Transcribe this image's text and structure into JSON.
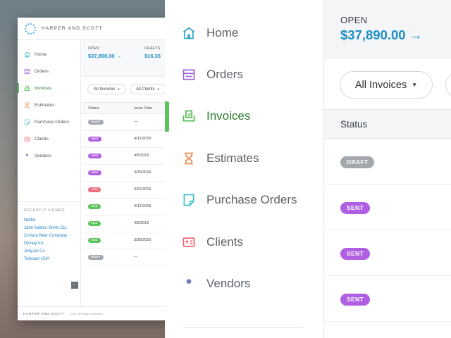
{
  "colors": {
    "accent_blue": "#1f8ec8",
    "active_green": "#5cc45c",
    "badge_draft": "#a3a8ad",
    "badge_sent": "#b05fe3",
    "badge_late": "#f0697b",
    "badge_paid": "#5cc45c"
  },
  "mini": {
    "brand": "HARPER AND SCOTT",
    "nav": [
      {
        "label": "Home",
        "icon": "home-icon",
        "color": "#27a0c9"
      },
      {
        "label": "Orders",
        "icon": "orders-icon",
        "color": "#a05ed8"
      },
      {
        "label": "Invoices",
        "icon": "invoices-icon",
        "color": "#4cb84c"
      },
      {
        "label": "Estimates",
        "icon": "estimates-icon",
        "color": "#f08a4b"
      },
      {
        "label": "Purchase Orders",
        "icon": "purchase-orders-icon",
        "color": "#3fc1c9"
      },
      {
        "label": "Clients",
        "icon": "clients-icon",
        "color": "#ef5d6e"
      },
      {
        "label": "Vendors",
        "icon": "vendors-icon",
        "color": "#6f79c4"
      }
    ],
    "recently_viewed_title": "RECENTLY VIEWED",
    "recently_viewed": [
      "Netflix",
      "John Adams Shirts Etc.",
      "Corona Beer Company",
      "Disney Inc.",
      "JellyJar Co",
      "Telecast USA"
    ],
    "footer_brand": "HARPER AND SCOTT",
    "footer_copy": "2016. All Rights Reserved",
    "stats": {
      "open_label": "OPEN",
      "open_value": "$37,890.00",
      "drafts_label": "DRAFTS",
      "drafts_value": "$16,35"
    },
    "filters": {
      "invoices": "All Invoices",
      "clients": "All Clients"
    },
    "columns": {
      "status": "Status",
      "issue_date": "Issue Date"
    },
    "rows": [
      {
        "status": "DRAFT",
        "date": "—",
        "kind": "draft"
      },
      {
        "status": "SENT",
        "date": "4/12/2016",
        "kind": "sent"
      },
      {
        "status": "SENT",
        "date": "4/5/2016",
        "kind": "sent"
      },
      {
        "status": "SENT",
        "date": "3/29/2016",
        "kind": "sent"
      },
      {
        "status": "LATE",
        "date": "3/22/2016",
        "kind": "late"
      },
      {
        "status": "PAID",
        "date": "4/12/2016",
        "kind": "paid"
      },
      {
        "status": "PAID",
        "date": "4/5/2016",
        "kind": "paid"
      },
      {
        "status": "PAID",
        "date": "3/29/2016",
        "kind": "paid"
      },
      {
        "status": "DRAFT",
        "date": "—",
        "kind": "draft"
      }
    ]
  },
  "zoom": {
    "nav": [
      {
        "label": "Home",
        "icon": "home-icon"
      },
      {
        "label": "Orders",
        "icon": "orders-icon"
      },
      {
        "label": "Invoices",
        "icon": "invoices-icon"
      },
      {
        "label": "Estimates",
        "icon": "estimates-icon"
      },
      {
        "label": "Purchase Orders",
        "icon": "purchase-orders-icon"
      },
      {
        "label": "Clients",
        "icon": "clients-icon"
      },
      {
        "label": "Vendors",
        "icon": "vendors-icon"
      }
    ],
    "active_index": 2,
    "open_label": "OPEN",
    "open_value": "$37,890.00",
    "filter_label": "All Invoices",
    "status_header": "Status",
    "rows": [
      {
        "status": "DRAFT",
        "kind": "draft"
      },
      {
        "status": "SENT",
        "kind": "sent"
      },
      {
        "status": "SENT",
        "kind": "sent"
      },
      {
        "status": "SENT",
        "kind": "sent"
      }
    ]
  }
}
